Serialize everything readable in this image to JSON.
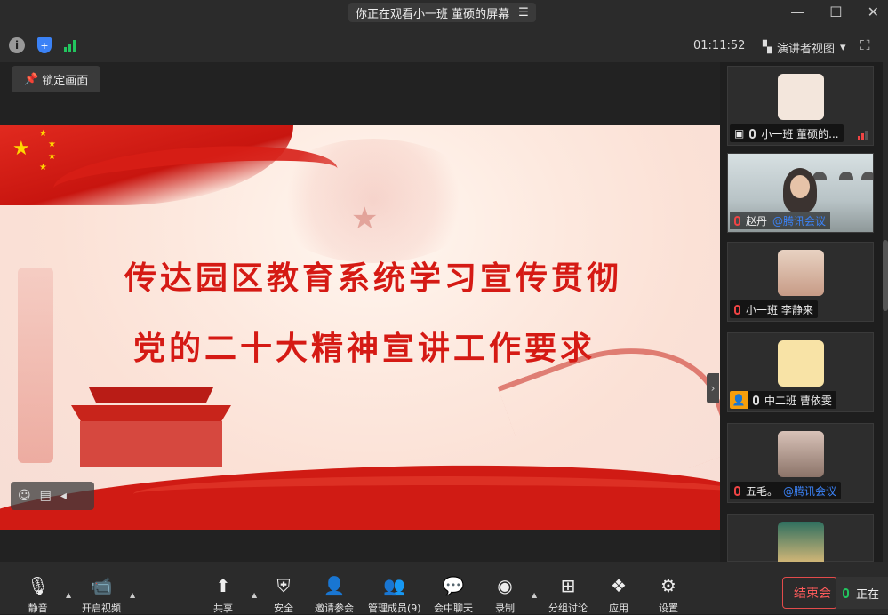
{
  "titlebar": {
    "viewing_text": "你正在观看小一班 董硕的屏幕",
    "menu_icon": "list-icon",
    "minimize": "—",
    "maximize": "☐",
    "close": "✕"
  },
  "status": {
    "timer": "01:11:52",
    "view_mode": "演讲者视图",
    "view_caret": "▾",
    "fullscreen": "⛶"
  },
  "lock_button": "锁定画面",
  "slide": {
    "title_line1": "传达园区教育系统学习宣传贯彻",
    "title_line2": "党的二十大精神宣讲工作要求"
  },
  "participants": [
    {
      "name": "小一班 董硕的...",
      "tag": "",
      "avatar_color": "#f3e6dc"
    },
    {
      "name": "赵丹",
      "tag": "@腾讯会议",
      "video": true
    },
    {
      "name": "小一班 李静来",
      "tag": "",
      "avatar_color": "#e0b9a2"
    },
    {
      "name": "中二班 曹依雯",
      "tag": "",
      "avatar_color": "#f8e3a6"
    },
    {
      "name": "五毛。",
      "tag": "@腾讯会议",
      "avatar_color": "#b39b8e"
    },
    {
      "name": "",
      "tag": "",
      "avatar_color": "#2f6f5f"
    }
  ],
  "toolbar": {
    "mute": "静音",
    "video": "开启视频",
    "share": "共享",
    "security": "安全",
    "invite": "邀请参会",
    "members": "管理成员(9)",
    "chat": "会中聊天",
    "record": "录制",
    "breakout": "分组讨论",
    "apps": "应用",
    "settings": "设置",
    "end": "结束会",
    "speaking": "正在"
  },
  "colors": {
    "accent_blue": "#3b82f6",
    "end_red": "#ff5b5b",
    "slide_red": "#d51a14"
  }
}
